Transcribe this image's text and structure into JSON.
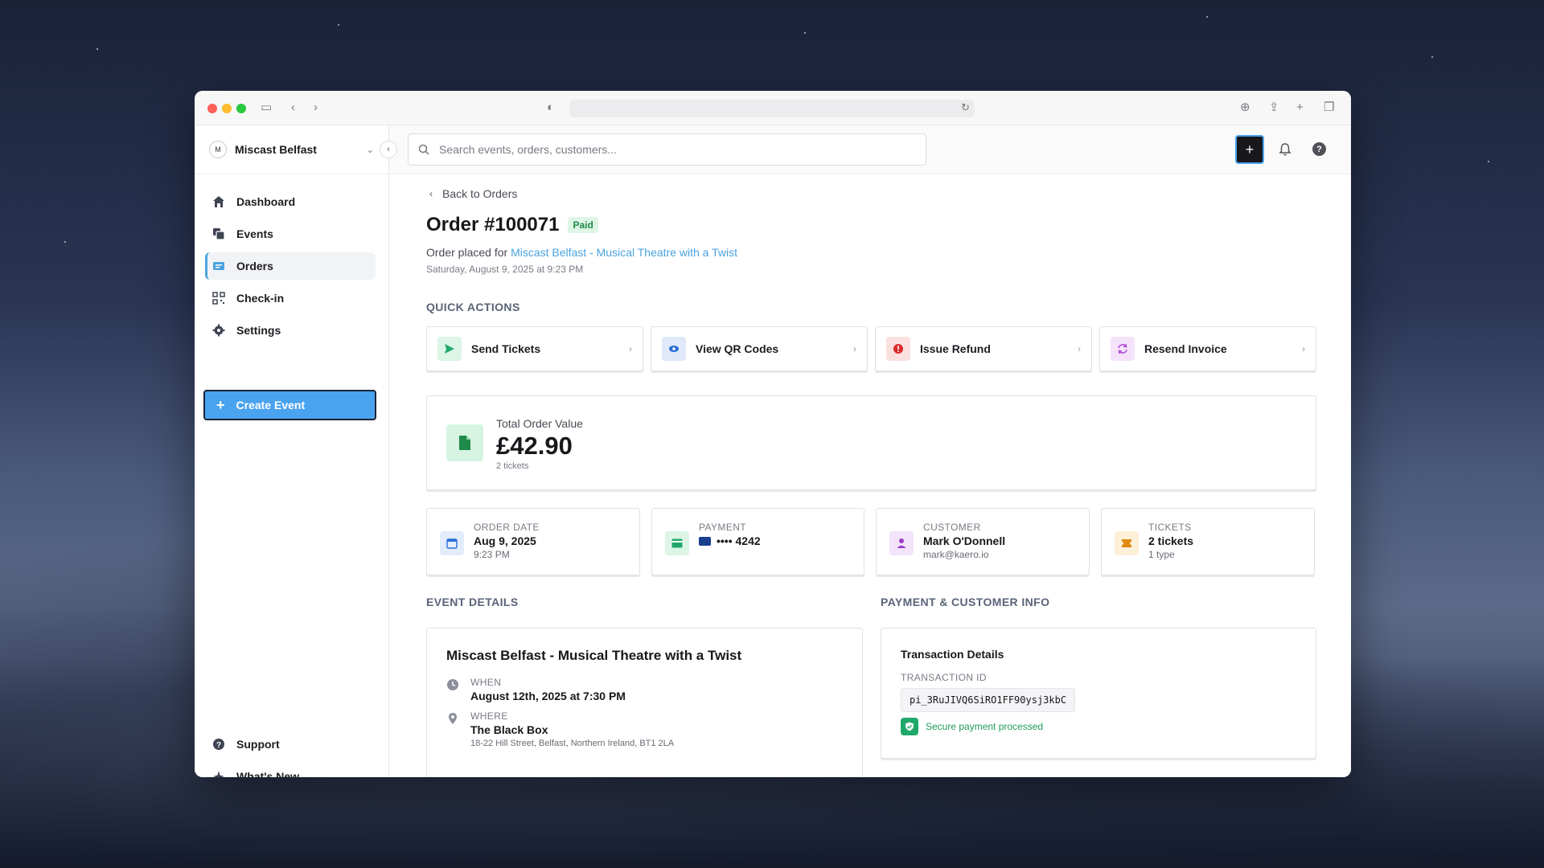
{
  "org": {
    "initial": "M",
    "name": "Miscast Belfast"
  },
  "nav": [
    {
      "label": "Dashboard"
    },
    {
      "label": "Events"
    },
    {
      "label": "Orders"
    },
    {
      "label": "Check-in"
    },
    {
      "label": "Settings"
    }
  ],
  "create_event_label": "Create Event",
  "bottom_nav": [
    {
      "label": "Support"
    },
    {
      "label": "What's New"
    }
  ],
  "search": {
    "placeholder": "Search events, orders, customers..."
  },
  "back_label": "Back to Orders",
  "order": {
    "title": "Order #100071",
    "status": "Paid",
    "placed_prefix": "Order placed for",
    "event_link": "Miscast Belfast - Musical Theatre with a Twist",
    "placed_date": "Saturday, August 9, 2025 at 9:23 PM"
  },
  "quick_actions": {
    "heading": "QUICK ACTIONS",
    "items": [
      {
        "label": "Send Tickets",
        "icon": "send-icon",
        "color": "#1fa86a",
        "bg": "#dcf5e6"
      },
      {
        "label": "View QR Codes",
        "icon": "eye-icon",
        "color": "#2a6fd6",
        "bg": "#dfe9fa"
      },
      {
        "label": "Issue Refund",
        "icon": "alert-icon",
        "color": "#d92c2c",
        "bg": "#fbe0e0"
      },
      {
        "label": "Resend Invoice",
        "icon": "refresh-icon",
        "color": "#b44fd6",
        "bg": "#f5e3fb"
      }
    ]
  },
  "total": {
    "label": "Total Order Value",
    "value": "£42.90",
    "sub": "2 tickets"
  },
  "stats": [
    {
      "label": "ORDER DATE",
      "value": "Aug 9, 2025",
      "sub": "9:23 PM",
      "icon": "calendar-icon",
      "bg": "#e2ecfb"
    },
    {
      "label": "PAYMENT",
      "value": "•••• 4242",
      "sub": "",
      "icon": "card-icon",
      "bg": "#dcf5e6"
    },
    {
      "label": "CUSTOMER",
      "value": "Mark O'Donnell",
      "sub": "mark@kaero.io",
      "icon": "user-icon",
      "bg": "#f3e3fb"
    },
    {
      "label": "TICKETS",
      "value": "2 tickets",
      "sub": "1 type",
      "icon": "ticket-icon",
      "bg": "#fdf0d8"
    }
  ],
  "event_details": {
    "heading": "EVENT DETAILS",
    "title": "Miscast Belfast - Musical Theatre with a Twist",
    "when_label": "WHEN",
    "when_value": "August 12th, 2025 at 7:30 PM",
    "where_label": "WHERE",
    "where_value": "The Black Box",
    "where_address": "18-22 Hill Street, Belfast, Northern Ireland, BT1 2LA"
  },
  "payment_info": {
    "heading": "PAYMENT & CUSTOMER INFO",
    "title": "Transaction Details",
    "tx_label": "TRANSACTION ID",
    "tx_id": "pi_3RuJIVQ6SiRO1FF90ysj3kbC",
    "secure_text": "Secure payment processed"
  }
}
